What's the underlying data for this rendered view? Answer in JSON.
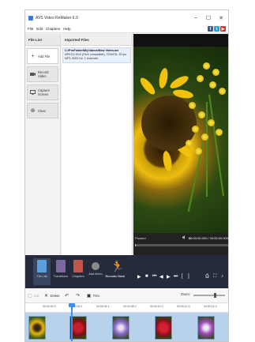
{
  "window": {
    "title": "AVS Video ReMaker 6.0"
  },
  "menubar": {
    "items": [
      "File",
      "Edit",
      "Chapters",
      "Help"
    ]
  },
  "social": {
    "facebook": "f",
    "twitter": "t",
    "youtube": "▶"
  },
  "sidebar": {
    "header": "File List",
    "buttons": [
      {
        "label": "Add File",
        "icon": "plus-icon"
      },
      {
        "label": "Record Video",
        "icon": "camera-icon"
      },
      {
        "label": "Capture Screen",
        "icon": "screen-icon"
      },
      {
        "label": "Clear",
        "icon": "clear-icon"
      }
    ]
  },
  "imported": {
    "header": "Imported Files",
    "files": [
      {
        "path": "C:\\ProFolder\\MyVideos\\New Video.avi",
        "details": "MPEG4 DivX (DivX compatible), 720x576, 25 fps",
        "audio": "MP3, 8000 Hz, 1 channels"
      }
    ]
  },
  "player": {
    "status": "Paused",
    "speed": "1x",
    "timecode": "00:00:00.000 / 00:00:00.000",
    "position_fraction": 0.01
  },
  "toolbar": {
    "tools": [
      {
        "label": "File List",
        "color": "#5aa0e0"
      },
      {
        "label": "Transitions",
        "color": "#7a6aa0"
      },
      {
        "label": "Chapters",
        "color": "#c2564a"
      },
      {
        "label": "Add Menu",
        "color": "#8a8a8a"
      },
      {
        "label": "Remake Now!",
        "color": "#e8a93a"
      }
    ]
  },
  "edit": {
    "cut": "Cut",
    "delete": "Delete",
    "undo": "↶",
    "redo": "↷",
    "trim": "Trim",
    "zoom_label": "Zoom:"
  },
  "timeline": {
    "ticks": [
      "00:00:02.0",
      "00:00:04.1",
      "00:00:06.1",
      "00:00:08.2",
      "00:00:10.2",
      "00:00:12.3",
      "00:00:14.3"
    ],
    "thumbnails": [
      "sunflower",
      "red-flower",
      "purple-flower",
      "red-flower-2",
      "purple-flower-2"
    ]
  },
  "colors": {
    "accent": "#3b8fe8",
    "toolbar_bg": "#252b3a",
    "track_bg": "#b9d2ec"
  }
}
